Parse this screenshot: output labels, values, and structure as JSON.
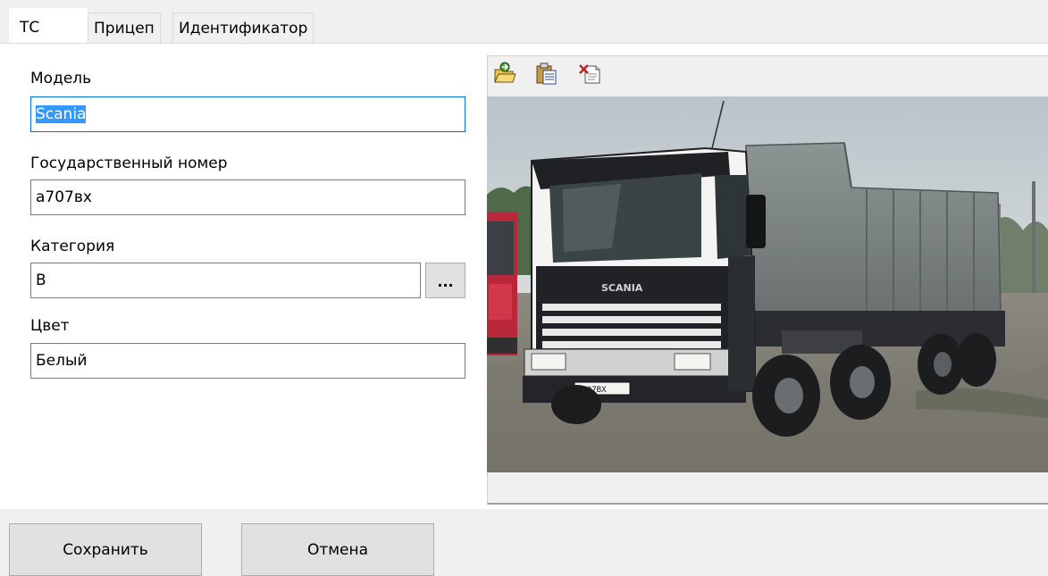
{
  "tabs": [
    {
      "label": "ТС",
      "active": true
    },
    {
      "label": "Прицеп",
      "active": false
    },
    {
      "label": "Идентификатор",
      "active": false
    }
  ],
  "form": {
    "model": {
      "label": "Модель",
      "value": "Scania"
    },
    "plate": {
      "label": "Государственный номер",
      "value": "а707вх"
    },
    "category": {
      "label": "Категория",
      "value": "В",
      "browse_label": "..."
    },
    "color": {
      "label": "Цвет",
      "value": "Белый"
    }
  },
  "photo": {
    "toolbar_icons": [
      "open-folder-icon",
      "paste-icon",
      "delete-image-icon"
    ],
    "truck_grille_text": "SCANIA",
    "truck_plate_text": "А707ВХ"
  },
  "buttons": {
    "save_label": "Сохранить",
    "cancel_label": "Отмена"
  },
  "colors": {
    "selection": "#3399ff",
    "focus_border": "#0078d7",
    "window_bg": "#f0f0f0"
  }
}
